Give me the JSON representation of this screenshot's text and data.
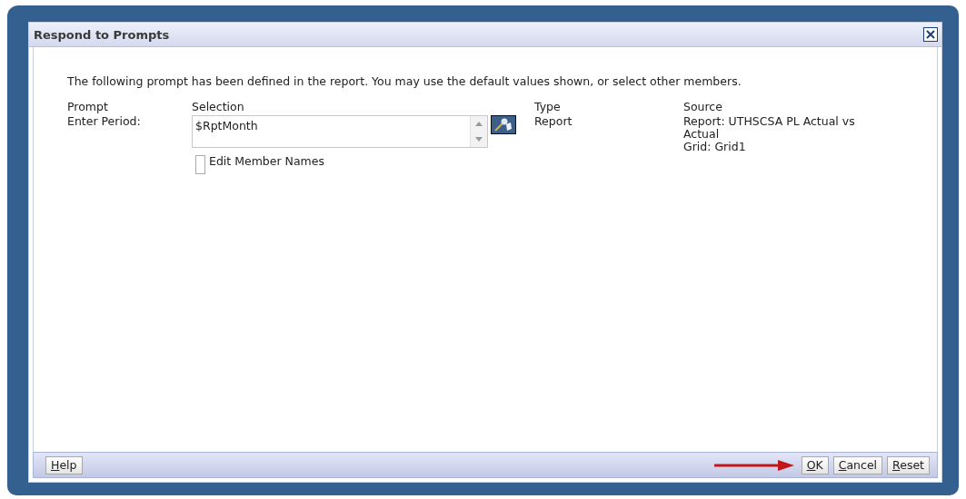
{
  "window": {
    "title": "Respond to Prompts"
  },
  "intro": "The following prompt has been defined in the report. You may use the default values shown, or select other members.",
  "columns": [
    "Prompt",
    "Selection",
    "Type",
    "Source"
  ],
  "prompts": [
    {
      "prompt": "Enter Period:",
      "selection": "$RptMonth",
      "edit_member_names": {
        "label": "Edit Member Names",
        "checked": false
      },
      "type": "Report",
      "source": [
        "Report: UTHSCSA PL Actual vs Actual",
        "Grid: Grid1"
      ]
    }
  ],
  "footer": {
    "left_buttons": [
      "Help"
    ],
    "right_buttons": [
      "OK",
      "Cancel",
      "Reset"
    ]
  }
}
